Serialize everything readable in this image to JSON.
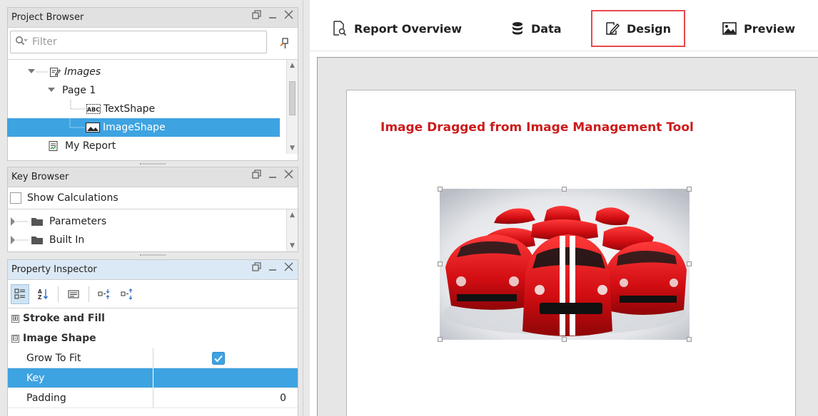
{
  "project_browser": {
    "title": "Project Browser",
    "filter_placeholder": "Filter",
    "tree": [
      {
        "label": "Images",
        "italic": true
      },
      {
        "label": "Page 1"
      },
      {
        "label": "TextShape"
      },
      {
        "label": "ImageShape",
        "selected": true
      },
      {
        "label": "My Report"
      }
    ]
  },
  "key_browser": {
    "title": "Key Browser",
    "show_calculations": "Show Calculations",
    "items": [
      {
        "label": "Parameters"
      },
      {
        "label": "Built In"
      }
    ]
  },
  "property_inspector": {
    "title": "Property Inspector",
    "categories": [
      {
        "label": "Stroke and Fill",
        "expander": "⊞"
      },
      {
        "label": "Image Shape",
        "expander": "⊟"
      }
    ],
    "rows": [
      {
        "key": "Grow To Fit",
        "value": "",
        "checked": true
      },
      {
        "key": "Key",
        "value": "",
        "selected": true
      },
      {
        "key": "Padding",
        "value": "0"
      }
    ]
  },
  "tabs": [
    {
      "label": "Report Overview",
      "icon": "report-overview-icon"
    },
    {
      "label": "Data",
      "icon": "database-icon"
    },
    {
      "label": "Design",
      "icon": "design-icon",
      "highlighted": true
    },
    {
      "label": "Preview",
      "icon": "preview-image-icon"
    }
  ],
  "report": {
    "title": "Image Dragged from Image Management Tool"
  },
  "colors": {
    "selection": "#3ea3e1",
    "title_red": "#cc1b1b",
    "highlight_border": "#e8484d"
  }
}
